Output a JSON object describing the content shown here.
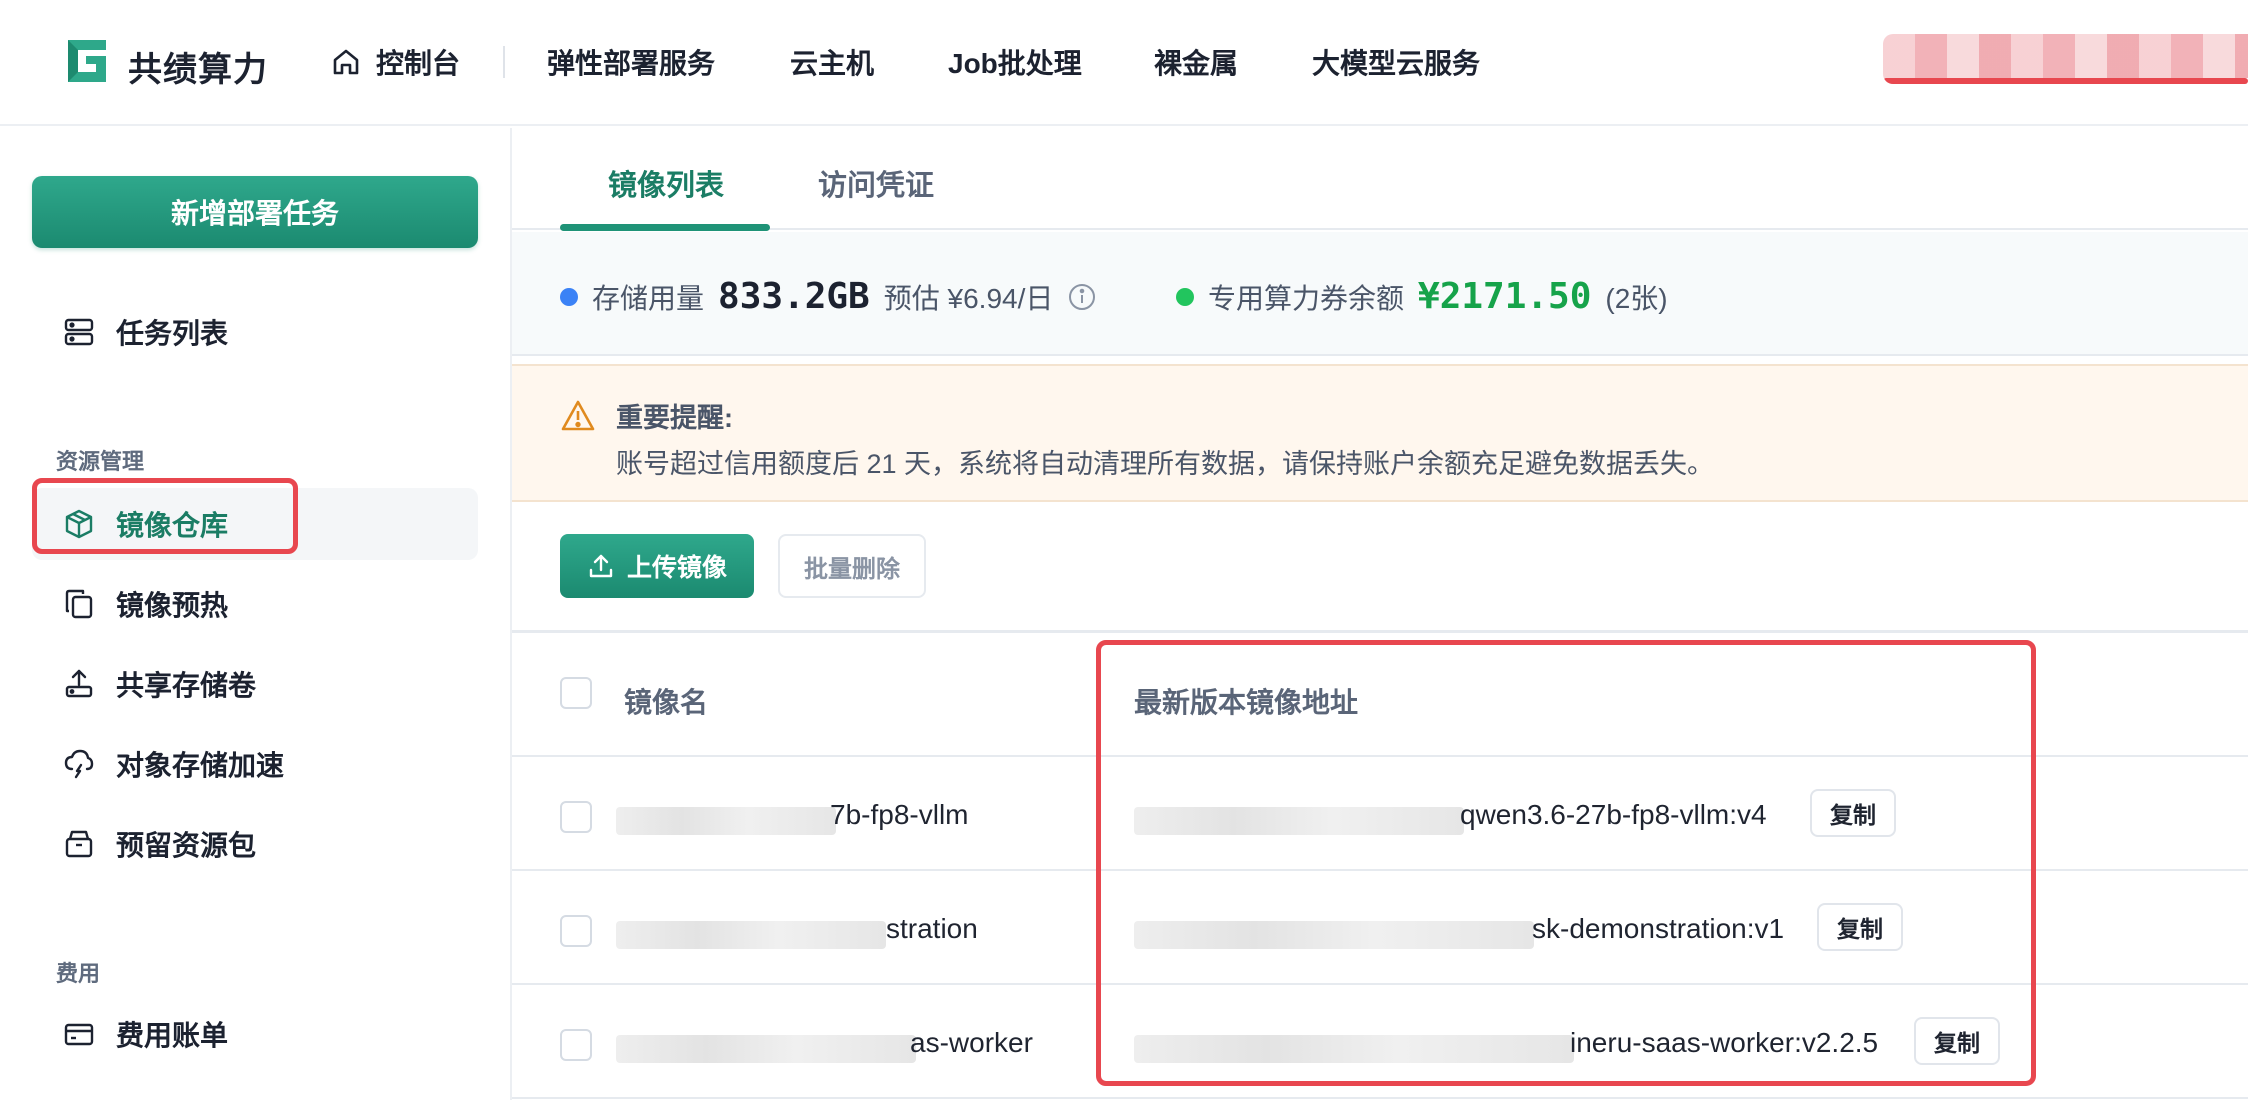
{
  "header": {
    "brand": "共绩算力",
    "home_label": "控制台",
    "nav": [
      "弹性部署服务",
      "云主机",
      "Job批处理",
      "裸金属",
      "大模型云服务"
    ]
  },
  "sidebar": {
    "new_task_label": "新增部署任务",
    "task_list_label": "任务列表",
    "section_resources": "资源管理",
    "items": [
      {
        "label": "镜像仓库",
        "icon": "cube-icon",
        "active": true
      },
      {
        "label": "镜像预热",
        "icon": "copy-icon"
      },
      {
        "label": "共享存储卷",
        "icon": "upload-tray-icon"
      },
      {
        "label": "对象存储加速",
        "icon": "cloud-sync-icon"
      },
      {
        "label": "预留资源包",
        "icon": "box-icon"
      }
    ],
    "section_billing": "费用",
    "billing_label": "费用账单"
  },
  "tabs": [
    "镜像列表",
    "访问凭证"
  ],
  "stats": {
    "storage_label": "存储用量",
    "storage_value": "833.2GB",
    "storage_estimate": "预估 ¥6.94/日",
    "voucher_label": "专用算力券余额",
    "voucher_value": "¥2171.50",
    "voucher_count": "(2张)",
    "colors": {
      "storage_dot": "#3b82f6",
      "voucher_dot": "#22c55e",
      "voucher_value": "#16a34a"
    }
  },
  "alert": {
    "title": "重要提醒:",
    "text": "账号超过信用额度后 21 天，系统将自动清理所有数据，请保持账户余额充足避免数据丢失。"
  },
  "toolbar": {
    "upload_label": "上传镜像",
    "batch_delete_label": "批量删除"
  },
  "table": {
    "columns": [
      "镜像名",
      "最新版本镜像地址"
    ],
    "copy_label": "复制",
    "rows": [
      {
        "name_suffix": "7b-fp8-vllm",
        "address_suffix": "qwen3.6-27b-fp8-vllm:v4"
      },
      {
        "name_suffix": "stration",
        "address_suffix": "sk-demonstration:v1"
      },
      {
        "name_suffix": "as-worker",
        "address_suffix": "ineru-saas-worker:v2.2.5"
      }
    ]
  },
  "brand_color": "#1f9377",
  "highlight_color": "#e8474f"
}
